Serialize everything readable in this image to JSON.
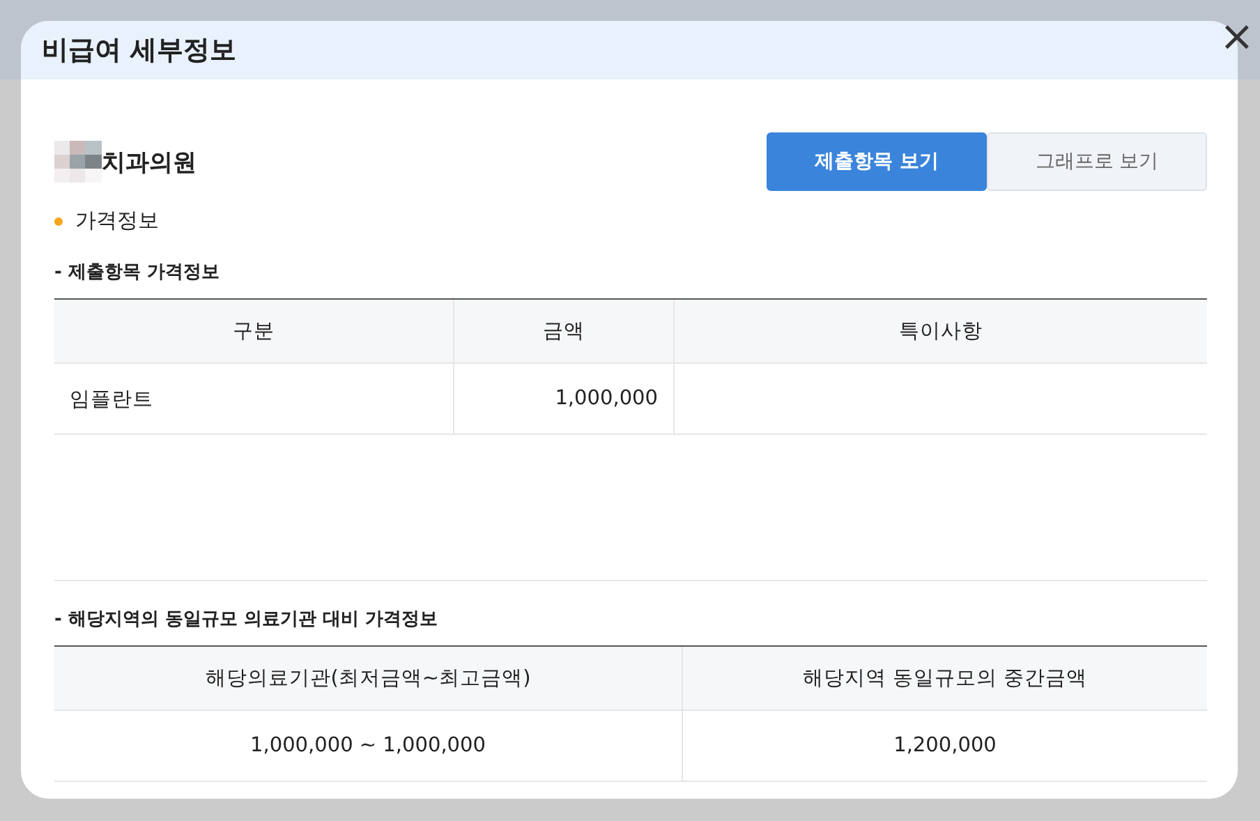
{
  "dialog": {
    "title": "비급여 세부정보",
    "close": "×"
  },
  "clinic": {
    "name": "치과의원"
  },
  "view_toggle": [
    {
      "label": "제출항목 보기",
      "selected": true
    },
    {
      "label": "그래프로 보기",
      "selected": false
    }
  ],
  "section": {
    "title": "가격정보"
  },
  "submitted": {
    "title": "- 제출항목 가격정보",
    "columns": [
      {
        "label": "구분",
        "kind": "text"
      },
      {
        "label": "금액",
        "kind": "amount"
      },
      {
        "label": "특이사항",
        "kind": "note"
      }
    ],
    "rows": [
      [
        "임플란트",
        "1,000,000",
        ""
      ]
    ]
  },
  "regional": {
    "title": "- 해당지역의 동일규모 의료기관 대비 가격정보",
    "columns": [
      {
        "label": "해당의료기관(최저금액~최고금액)",
        "kind": "summary"
      },
      {
        "label": "해당지역 동일규모의 중간금액",
        "kind": "summary"
      }
    ],
    "rows": [
      [
        "1,000,000 ~ 1,000,000",
        "1,200,000"
      ]
    ]
  }
}
